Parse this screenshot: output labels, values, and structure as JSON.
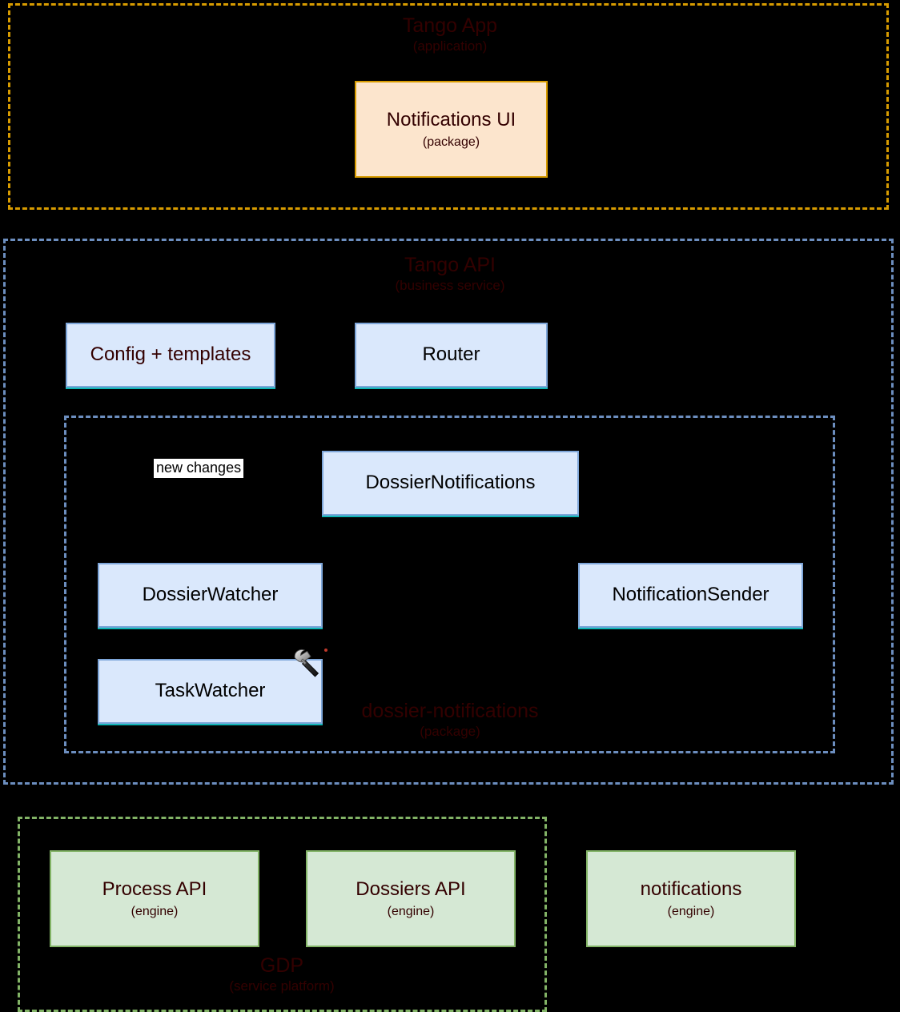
{
  "diagram": {
    "background_color": "#000000",
    "groups": [
      {
        "id": "tango-app",
        "title": "Tango App",
        "subtitle": "(application)",
        "border_color": "#d79b00",
        "border_style": "dashed"
      },
      {
        "id": "tango-api",
        "title": "Tango API",
        "subtitle": "(business service)",
        "border_color": "#6c8ebf",
        "border_style": "dashed"
      },
      {
        "id": "dossier-notifications",
        "title": "dossier-notifications",
        "subtitle": "(package)",
        "border_color": "#6c8ebf",
        "border_style": "dashed"
      },
      {
        "id": "gdp",
        "title": "GDP",
        "subtitle": "(service platform)",
        "border_color": "#82b366",
        "border_style": "dashed"
      }
    ],
    "nodes": [
      {
        "id": "notifications-ui",
        "title": "Notifications UI",
        "subtitle": "(package)",
        "fill": "#fce5cd",
        "stroke": "#d79b00"
      },
      {
        "id": "config-templates",
        "title": "Config + templates",
        "subtitle": "",
        "fill": "#dae8fc",
        "stroke": "#7ea6d9"
      },
      {
        "id": "router",
        "title": "Router",
        "subtitle": "",
        "fill": "#dae8fc",
        "stroke": "#7ea6d9"
      },
      {
        "id": "dossier-notifications-class",
        "title": "DossierNotifications",
        "subtitle": "",
        "fill": "#dae8fc",
        "stroke": "#7ea6d9"
      },
      {
        "id": "dossier-watcher",
        "title": "DossierWatcher",
        "subtitle": "",
        "fill": "#dae8fc",
        "stroke": "#7ea6d9"
      },
      {
        "id": "notification-sender",
        "title": "NotificationSender",
        "subtitle": "",
        "fill": "#dae8fc",
        "stroke": "#7ea6d9"
      },
      {
        "id": "task-watcher",
        "title": "TaskWatcher",
        "subtitle": "",
        "fill": "#dae8fc",
        "stroke": "#7ea6d9"
      },
      {
        "id": "process-api",
        "title": "Process API",
        "subtitle": "(engine)",
        "fill": "#d5e8d4",
        "stroke": "#82b366"
      },
      {
        "id": "dossiers-api",
        "title": "Dossiers API",
        "subtitle": "(engine)",
        "fill": "#d5e8d4",
        "stroke": "#82b366"
      },
      {
        "id": "notifications-engine",
        "title": "notifications",
        "subtitle": "(engine)",
        "fill": "#d5e8d4",
        "stroke": "#82b366"
      }
    ],
    "edge_labels": [
      {
        "id": "new-changes",
        "text": "new changes"
      }
    ],
    "cursor": {
      "icon": "hammer-cursor-icon"
    }
  }
}
